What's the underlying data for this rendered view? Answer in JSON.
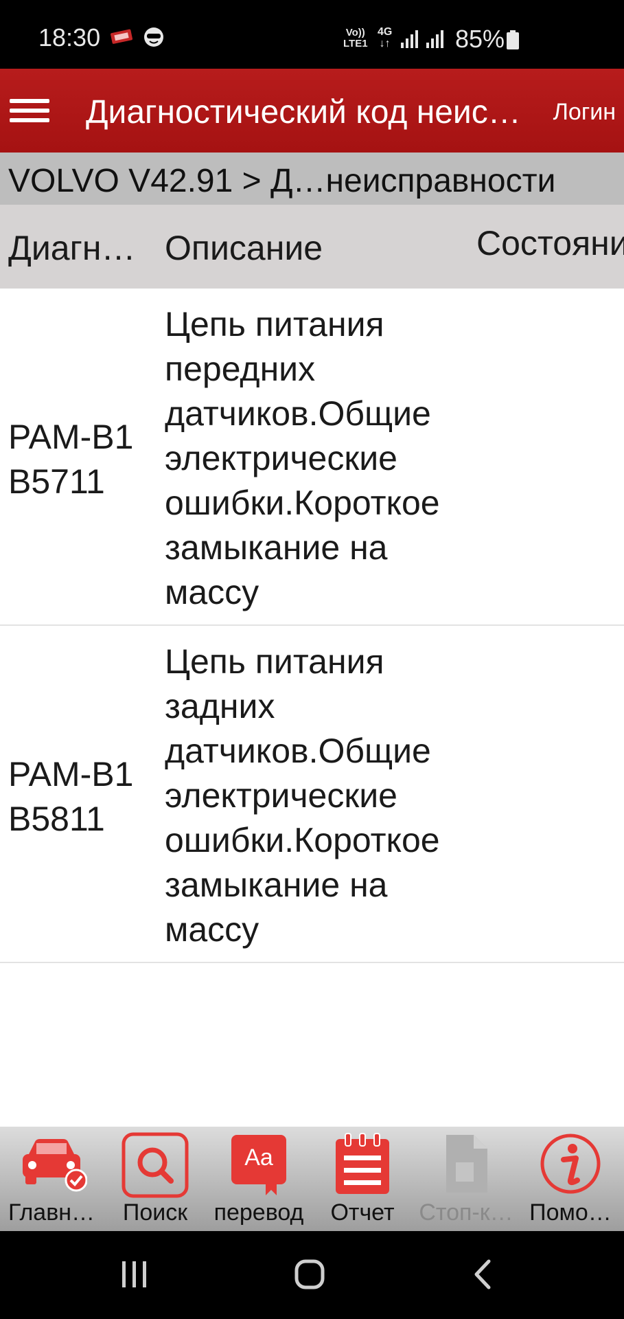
{
  "status_bar": {
    "time": "18:30",
    "volte_line1": "Vo))",
    "volte_line2": "LTE1",
    "network": "4G",
    "battery_percent": "85%",
    "battery_level": 0.85
  },
  "app_bar": {
    "title": "Диагностический код неисправности",
    "login_label": "Логин"
  },
  "breadcrumb": "VOLVO V42.91 > Д…неисправности",
  "table": {
    "columns": [
      "Диагн…",
      "Описание",
      "Состояние"
    ],
    "rows": [
      {
        "code": "PAM-B1 B5711",
        "description": "Цепь питания передних датчиков.Общие электрические ошибки.Короткое замыкание на массу",
        "state": ""
      },
      {
        "code": "PAM-B1 B5811",
        "description": "Цепь питания задних датчиков.Общие электрические ошибки.Короткое замыкание на массу",
        "state": ""
      }
    ]
  },
  "toolbar": {
    "items": [
      {
        "label": "Главн…",
        "icon": "car-check-icon",
        "enabled": true
      },
      {
        "label": "Поиск",
        "icon": "search-icon",
        "enabled": true
      },
      {
        "label": "перевод",
        "icon": "translate-icon",
        "enabled": true
      },
      {
        "label": "Отчет",
        "icon": "report-icon",
        "enabled": true
      },
      {
        "label": "Стоп-к…",
        "icon": "document-icon",
        "enabled": false
      },
      {
        "label": "Помо…",
        "icon": "info-icon",
        "enabled": true
      }
    ]
  },
  "colors": {
    "accent": "#b71c1c",
    "icon_red": "#e53935",
    "disabled_gray": "#a8a8a8"
  }
}
